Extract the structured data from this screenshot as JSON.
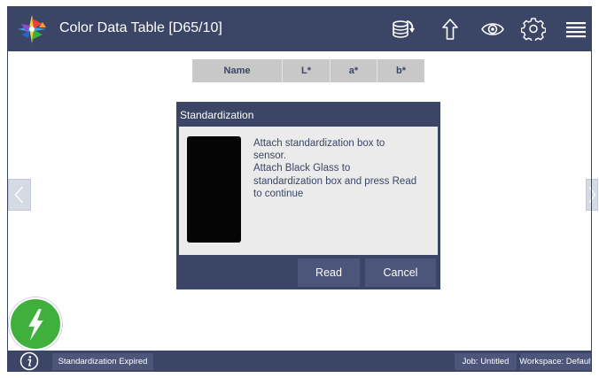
{
  "app": {
    "title": "Color Data Table [D65/10]"
  },
  "toolbar": {
    "icons": [
      "database-sync-icon",
      "upload-arrow-icon",
      "eye-icon",
      "gear-icon",
      "hamburger-menu-icon"
    ]
  },
  "table": {
    "columns": [
      "Name",
      "L*",
      "a*",
      "b*"
    ]
  },
  "dialog": {
    "title": "Standardization",
    "message_lines": [
      "Attach standardization box to",
      "sensor.",
      "Attach Black Glass to",
      "standardization box and press Read",
      "to continue"
    ],
    "read_label": "Read",
    "cancel_label": "Cancel"
  },
  "status": {
    "standardization": "Standardization Expired",
    "job": "Job: Untitled",
    "workspace": "Workspace: Default"
  },
  "colors": {
    "bar": "#3b4566",
    "button": "#4c567a",
    "fab": "#3fb03b",
    "dialog_body": "#ebebeb",
    "table_header": "#c8c8c8"
  }
}
